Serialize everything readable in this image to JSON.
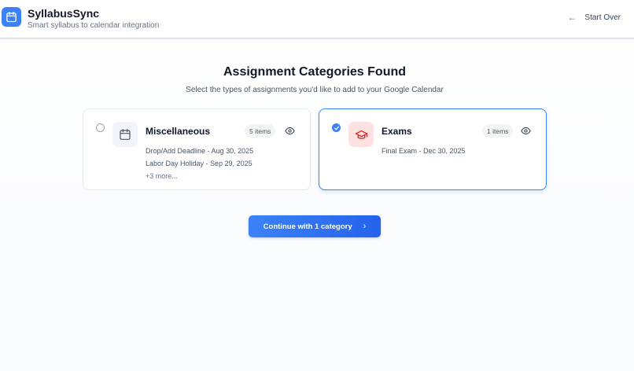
{
  "header": {
    "title": "SyllabusSync",
    "subtitle": "Smart syllabus to calendar integration",
    "start_over_label": "Start Over",
    "brand_color": "#3b82f6"
  },
  "main": {
    "title": "Assignment Categories Found",
    "subtitle": "Select the types of assignments you'd like to add to your Google Calendar",
    "categories": [
      {
        "name": "Miscellaneous",
        "icon": "calendar-icon",
        "count_label": "5 items",
        "selected": false,
        "items": [
          "Drop/Add Deadline - Aug 30, 2025",
          "Labor Day Holiday - Sep 29, 2025"
        ],
        "more_label": "+3 more..."
      },
      {
        "name": "Exams",
        "icon": "graduation-cap-icon",
        "count_label": "1 items",
        "selected": true,
        "items": [
          "Final Exam - Dec 30, 2025"
        ]
      }
    ],
    "continue_label": "Continue with 1 category"
  }
}
